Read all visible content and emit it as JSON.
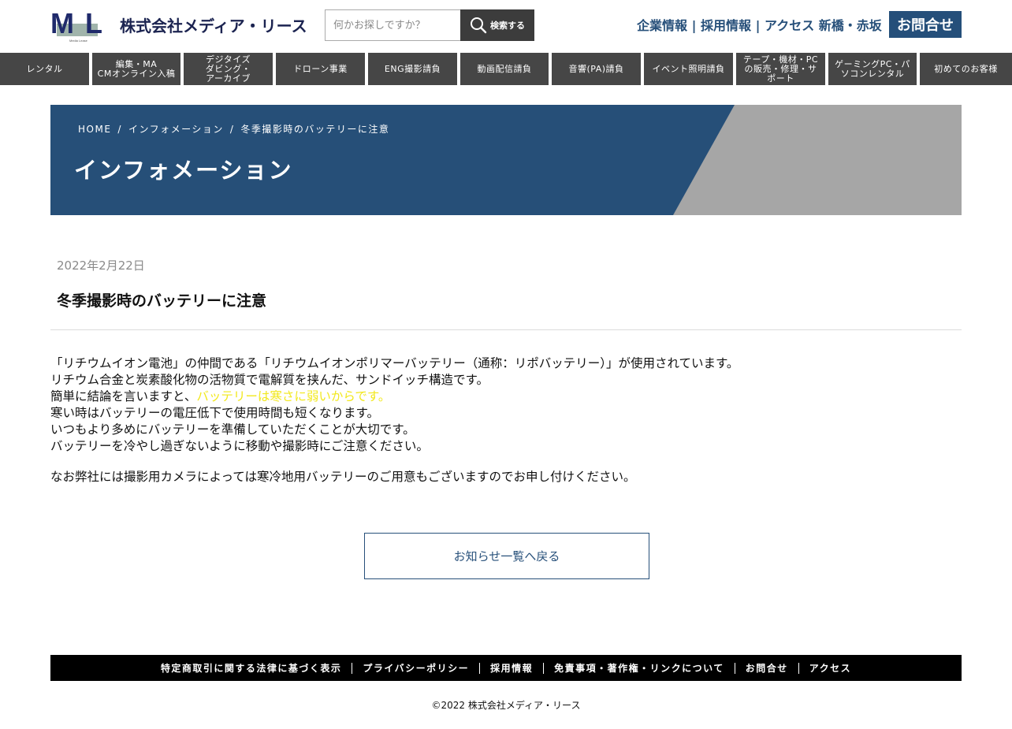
{
  "header": {
    "logo_text": "ML",
    "logo_sub": "Media Lease",
    "company_name": "株式会社メディア・リース",
    "search": {
      "placeholder": "何かお探しですか？",
      "button_label": "検索する"
    },
    "links": [
      "企業情報",
      "採用情報",
      "アクセス 新橋・赤坂"
    ],
    "link_sep": " | ",
    "contact_label": "お問合せ"
  },
  "nav": {
    "items": [
      "レンタル",
      "編集・MA\nCMオンライン入稿",
      "デジタイズ\nダビング・\nアーカイブ",
      "ドローン事業",
      "ENG撮影請負",
      "動画配信請負",
      "音響(PA)請負",
      "イベント照明請負",
      "テープ・機材・PC\nの販売・修理・サ\nポート",
      "ゲーミングPC・パ\nソコンレンタル",
      "初めてのお客様"
    ]
  },
  "banner": {
    "breadcrumb": [
      "HOME",
      "インフォメーション",
      "冬季撮影時のバッテリーに注意"
    ],
    "breadcrumb_sep": "/",
    "title": "インフォメーション"
  },
  "article": {
    "date": "2022年2月22日",
    "title": "冬季撮影時のバッテリーに注意",
    "lines": [
      "「リチウムイオン電池」の仲間である「リチウムイオンポリマーバッテリー（通称：リポバッテリー）」が使用されています。",
      "リチウム合金と炭素酸化物の活物質で電解質を挟んだ、サンドイッチ構造です。"
    ],
    "line3_prefix": "簡単に結論を言いますと、",
    "line3_highlight": "バッテリーは寒さに弱いからです。",
    "lines_after": [
      "寒い時はバッテリーの電圧低下で使用時間も短くなります。",
      "いつもより多めにバッテリーを準備していただくことが大切です。",
      "バッテリーを冷やし過ぎないように移動や撮影時にご注意ください。"
    ],
    "paragraph2": "なお弊社には撮影用カメラによっては寒冷地用バッテリーのご用意もございますのでお申し付けください。",
    "highlight_color": "#f2e81d",
    "back_label": "お知らせ一覧へ戻る"
  },
  "footer": {
    "links": [
      "特定商取引に関する法律に基づく表示",
      "プライバシーポリシー",
      "採用情報",
      "免責事項・著作権・リンクについて",
      "お問合せ",
      "アクセス"
    ],
    "copyright": "©2022 株式会社メディア・リース"
  },
  "colors": {
    "brand_blue": "#264f78",
    "nav_bg": "#464646",
    "footer_bg": "#000000"
  }
}
